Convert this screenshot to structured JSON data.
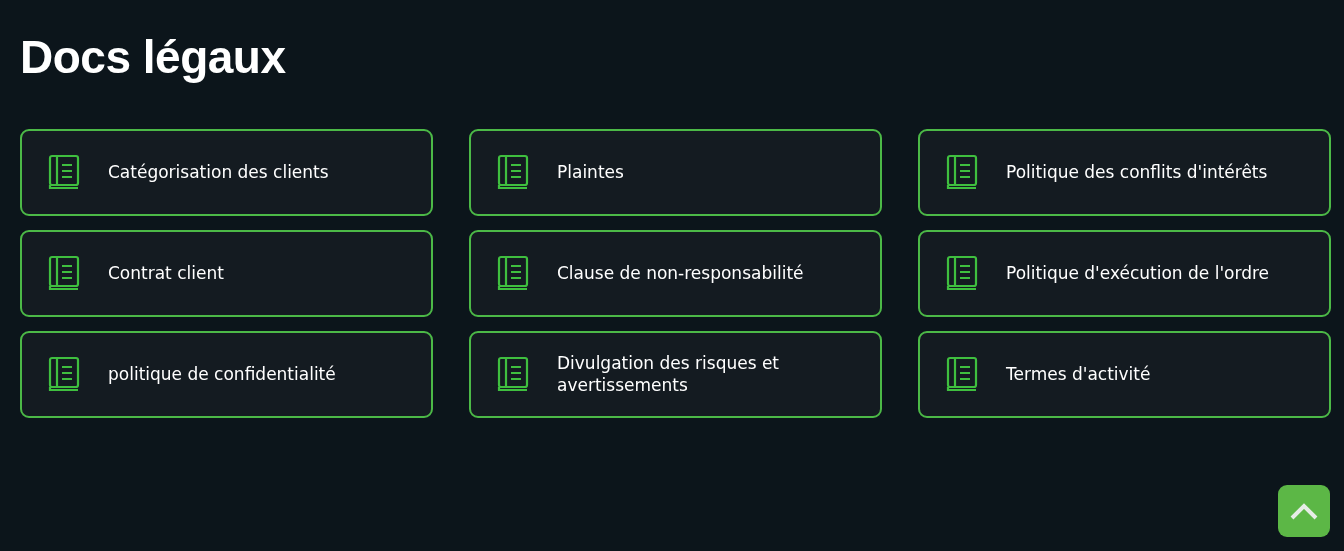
{
  "title": "Docs légaux",
  "documents": [
    {
      "label": "Catégorisation des clients"
    },
    {
      "label": "Plaintes"
    },
    {
      "label": "Politique des conflits d'intérêts"
    },
    {
      "label": "Contrat client"
    },
    {
      "label": "Clause de non-responsabilité"
    },
    {
      "label": "Politique d'exécution de l'ordre"
    },
    {
      "label": "politique de confidentialité"
    },
    {
      "label": "Divulgation des risques et avertissements"
    },
    {
      "label": "Termes d'activité"
    }
  ]
}
